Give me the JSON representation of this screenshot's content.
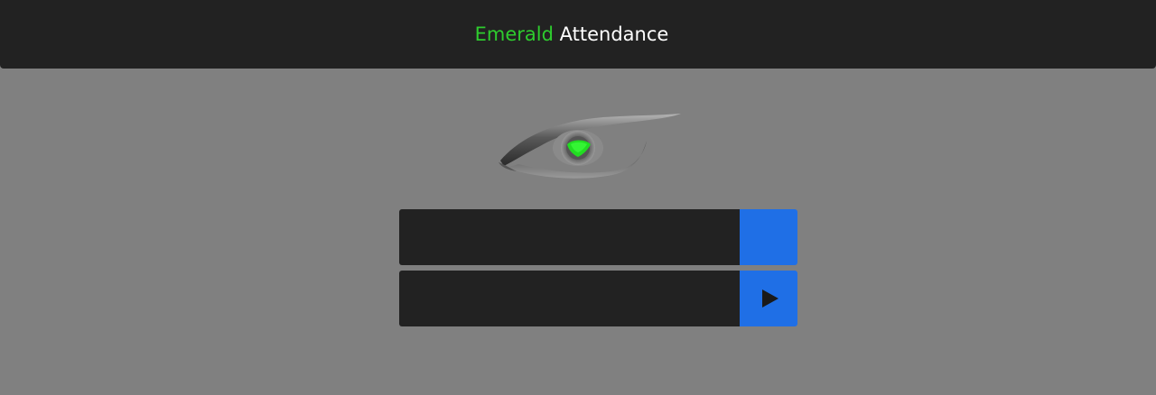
{
  "header": {
    "title_accent": "Emerald",
    "title_main": "Attendance",
    "accent_color": "#2ecc2e"
  },
  "logo": {
    "icon": "eye-icon",
    "iris_color": "#22dd22"
  },
  "form": {
    "field1": {
      "value": "",
      "placeholder": ""
    },
    "field2": {
      "value": "",
      "placeholder": ""
    },
    "submit_icon": "play-icon",
    "button_color": "#1f6fe6"
  }
}
